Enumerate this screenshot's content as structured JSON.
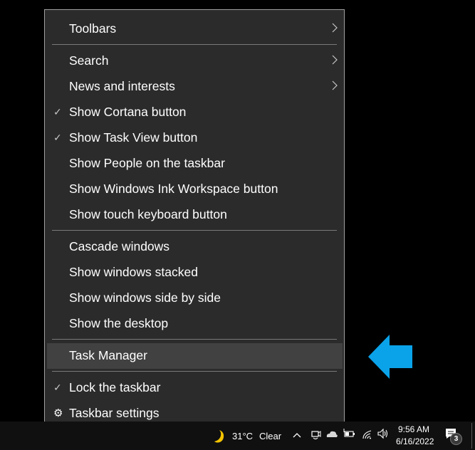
{
  "context_menu": {
    "items": [
      {
        "label": "Toolbars",
        "submenu": true,
        "checked": false
      },
      {
        "label": "Search",
        "submenu": true,
        "checked": false
      },
      {
        "label": "News and interests",
        "submenu": true,
        "checked": false
      },
      {
        "label": "Show Cortana button",
        "submenu": false,
        "checked": true
      },
      {
        "label": "Show Task View button",
        "submenu": false,
        "checked": true
      },
      {
        "label": "Show People on the taskbar",
        "submenu": false,
        "checked": false
      },
      {
        "label": "Show Windows Ink Workspace button",
        "submenu": false,
        "checked": false
      },
      {
        "label": "Show touch keyboard button",
        "submenu": false,
        "checked": false
      },
      {
        "label": "Cascade windows",
        "submenu": false,
        "checked": false
      },
      {
        "label": "Show windows stacked",
        "submenu": false,
        "checked": false
      },
      {
        "label": "Show windows side by side",
        "submenu": false,
        "checked": false
      },
      {
        "label": "Show the desktop",
        "submenu": false,
        "checked": false
      },
      {
        "label": "Task Manager",
        "submenu": false,
        "checked": false,
        "highlighted": true
      },
      {
        "label": "Lock the taskbar",
        "submenu": false,
        "checked": true
      },
      {
        "label": "Taskbar settings",
        "submenu": false,
        "checked": false,
        "icon": "gear-icon"
      }
    ],
    "check_glyph": "✓",
    "gear_glyph": "⚙"
  },
  "annotation": {
    "icon": "left-arrow-icon",
    "color": "#0aa3ea"
  },
  "taskbar": {
    "weather": {
      "icon": "moon-icon",
      "temperature": "31°C",
      "condition": "Clear"
    },
    "tray_icons": [
      "chevron-up-icon",
      "meet-now-icon",
      "onedrive-cloud-icon",
      "battery-charging-icon",
      "wifi-icon",
      "volume-icon"
    ],
    "clock": {
      "time": "9:56 AM",
      "date": "6/16/2022"
    },
    "notifications": {
      "icon": "action-center-icon",
      "count": "3"
    }
  }
}
